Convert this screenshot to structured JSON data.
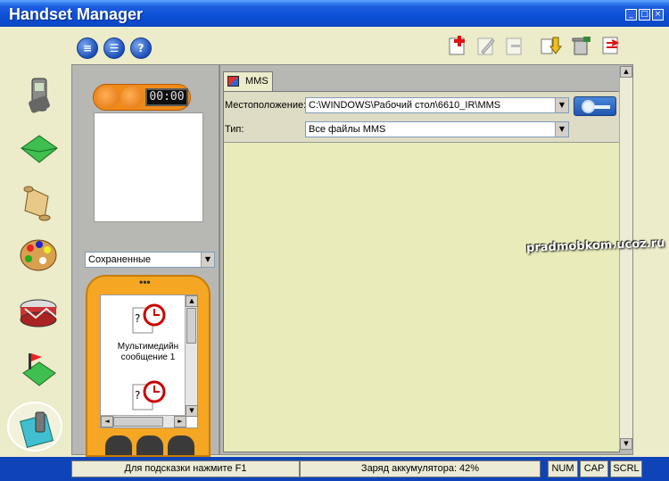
{
  "window": {
    "title": "Handset Manager",
    "controls": [
      "_",
      "□",
      "×"
    ]
  },
  "toolbar": {
    "left_buttons": [
      {
        "icon": "document-icon",
        "glyph": "≡"
      },
      {
        "icon": "list-icon",
        "glyph": "☰"
      },
      {
        "icon": "help-icon",
        "glyph": "?"
      }
    ],
    "right_icons": [
      "new-icon",
      "edit-icon",
      "delete-icon",
      "send-icon",
      "trash-icon",
      "sync-icon"
    ]
  },
  "sidebar": {
    "items": [
      "phone-icon",
      "message-icon",
      "scroll-icon",
      "palette-icon",
      "drum-icon",
      "mms-icon",
      "phone-settings-icon"
    ],
    "selected_index": 5
  },
  "player": {
    "counter": "00:00"
  },
  "left_combo": {
    "value": "Сохраненные"
  },
  "phone_list": {
    "dots": "•••",
    "items": [
      {
        "label": "Мультимедийн сообщение 1"
      },
      {
        "label": ""
      }
    ]
  },
  "main": {
    "tab_label": "MMS",
    "location_label": "Местоположение:",
    "location_value": "C:\\WINDOWS\\Рабочий стол\\6610_IR\\MMS",
    "type_label": "Тип:",
    "type_value": "Все файлы MMS"
  },
  "statusbar": {
    "hint": "Для подсказки нажмите F1",
    "battery": "Заряд аккумулятора: 42%",
    "num": "NUM",
    "cap": "CAP",
    "scrl": "SCRL"
  },
  "watermark": "pradmobkom.ucoz.ru",
  "colors": {
    "titlebar": "#0a4fd6",
    "background": "#ecebca",
    "panel": "#e9ecba",
    "accent_orange": "#f5a623"
  }
}
